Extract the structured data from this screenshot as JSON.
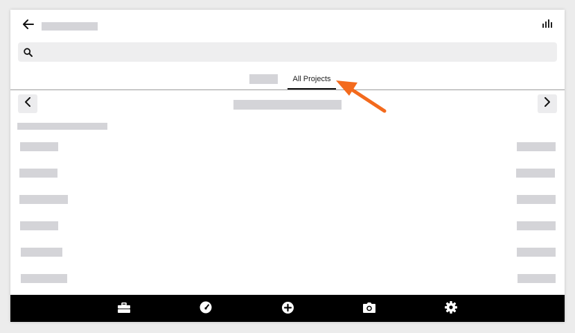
{
  "tabs": [
    {
      "label": "",
      "placeholder": true
    },
    {
      "label": "All Projects",
      "selected": true
    }
  ],
  "icons": {
    "back": "arrow-left-icon",
    "analytics": "bar-chart-icon",
    "search": "search-icon",
    "prev": "chevron-left-icon",
    "next": "chevron-right-icon",
    "bottom_nav": [
      "briefcase-icon",
      "gauge-icon",
      "plus-circle-icon",
      "camera-icon",
      "gear-icon"
    ]
  },
  "colors": {
    "annotation_arrow": "#f36a1d",
    "bottom_bar": "#000000",
    "placeholder": "#d4d4d8"
  }
}
